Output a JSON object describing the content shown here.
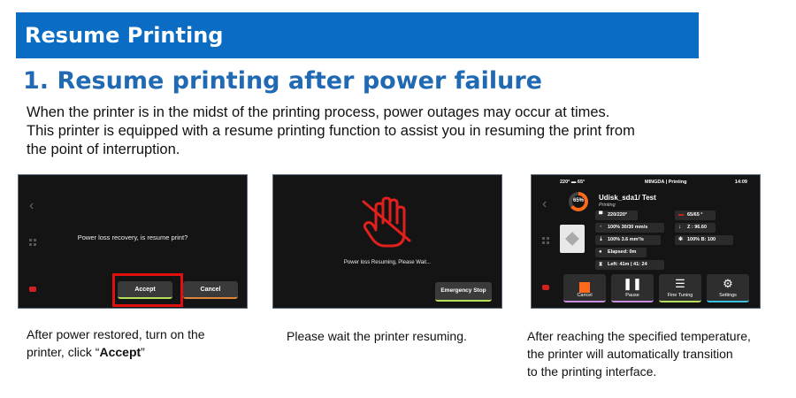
{
  "banner": {
    "title": "Resume Printing"
  },
  "section": {
    "heading": "1. Resume printing after power failure"
  },
  "intro": {
    "line1": "When the printer is in the midst of the printing process, power outages may occur at times.",
    "line2": "This printer is equipped with a resume printing function to assist you in resuming the print from",
    "line3": "the point of interruption."
  },
  "screen1": {
    "prompt": "Power loss recovery, is resume print?",
    "accept_label": "Accept",
    "cancel_label": "Cancel"
  },
  "screen2": {
    "wait_text": "Power loss Resuming, Please Wait...",
    "estop_label": "Emergency Stop"
  },
  "screen3": {
    "topbar": {
      "temps": "220° ▬ 65°",
      "status": "MINGDA | Printing",
      "time": "14:09"
    },
    "progress": "65%",
    "progress_value": 65,
    "file_name": "Udisk_sda1/ Test",
    "file_state": "Printing",
    "stats": {
      "nozzle": "220/220°",
      "bed": "65/65 °",
      "z": "Z : 96.60",
      "speed": "100% 30/30 mm/s",
      "flow": "100%  3.6 mm³/s",
      "fan": "100% B: 100",
      "elapsed": "Elapsed: 0m",
      "left": "Left: 41m | 41: 24"
    },
    "buttons": {
      "cancel": "Cancel",
      "pause": "Pause",
      "fine_tuning": "Fine Tuning",
      "settings": "Settings"
    }
  },
  "captions": {
    "cap1_line1": "After power restored, turn on the",
    "cap1_line2_pre": "printer, click “",
    "cap1_line2_bold": "Accept",
    "cap1_line2_post": "”",
    "cap2": "Please wait the printer resuming.",
    "cap3_line1": "After reaching the specified temperature,",
    "cap3_line2": "the printer will automatically transition",
    "cap3_line3": "to the printing interface."
  },
  "colors": {
    "banner": "#0a6cc2",
    "heading": "#2069b3",
    "accent_green": "#b6e05a",
    "accent_orange": "#ff6a1a",
    "highlight_red": "#e01010"
  }
}
